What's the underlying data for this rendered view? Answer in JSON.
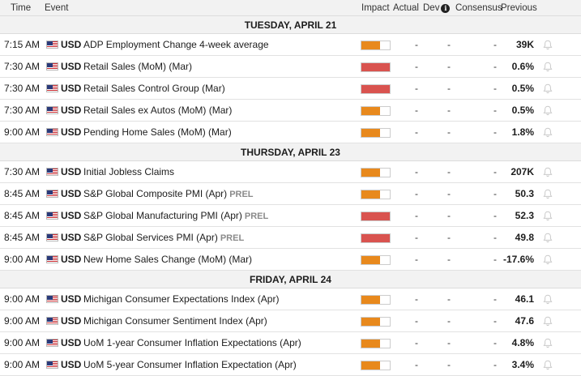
{
  "colors": {
    "impact_medium": "#e8891d",
    "impact_high": "#d9534f",
    "header_bg": "#f2f2f2"
  },
  "header": {
    "time": "Time",
    "event": "Event",
    "impact": "Impact",
    "actual": "Actual",
    "dev": "Dev",
    "info_icon": "i",
    "consensus": "Consensus",
    "previous": "Previous"
  },
  "days": [
    {
      "label": "TUESDAY, APRIL 21",
      "events": [
        {
          "time": "7:15 AM",
          "currency": "USD",
          "name": "ADP Employment Change 4-week average",
          "tag": "",
          "impact": "medium",
          "impact_level": 0.67,
          "actual": "-",
          "dev": "-",
          "consensus": "-",
          "previous": "39K"
        },
        {
          "time": "7:30 AM",
          "currency": "USD",
          "name": "Retail Sales (MoM) (Mar)",
          "tag": "",
          "impact": "high",
          "impact_level": 1,
          "actual": "-",
          "dev": "-",
          "consensus": "-",
          "previous": "0.6%"
        },
        {
          "time": "7:30 AM",
          "currency": "USD",
          "name": "Retail Sales Control Group (Mar)",
          "tag": "",
          "impact": "high",
          "impact_level": 1,
          "actual": "-",
          "dev": "-",
          "consensus": "-",
          "previous": "0.5%"
        },
        {
          "time": "7:30 AM",
          "currency": "USD",
          "name": "Retail Sales ex Autos (MoM) (Mar)",
          "tag": "",
          "impact": "medium",
          "impact_level": 0.67,
          "actual": "-",
          "dev": "-",
          "consensus": "-",
          "previous": "0.5%"
        },
        {
          "time": "9:00 AM",
          "currency": "USD",
          "name": "Pending Home Sales (MoM) (Mar)",
          "tag": "",
          "impact": "medium",
          "impact_level": 0.67,
          "actual": "-",
          "dev": "-",
          "consensus": "-",
          "previous": "1.8%"
        }
      ]
    },
    {
      "label": "THURSDAY, APRIL 23",
      "events": [
        {
          "time": "7:30 AM",
          "currency": "USD",
          "name": "Initial Jobless Claims",
          "tag": "",
          "impact": "medium",
          "impact_level": 0.67,
          "actual": "-",
          "dev": "-",
          "consensus": "-",
          "previous": "207K"
        },
        {
          "time": "8:45 AM",
          "currency": "USD",
          "name": "S&P Global Composite PMI (Apr)",
          "tag": "PREL",
          "impact": "medium",
          "impact_level": 0.67,
          "actual": "-",
          "dev": "-",
          "consensus": "-",
          "previous": "50.3"
        },
        {
          "time": "8:45 AM",
          "currency": "USD",
          "name": "S&P Global Manufacturing PMI (Apr)",
          "tag": "PREL",
          "impact": "high",
          "impact_level": 1,
          "actual": "-",
          "dev": "-",
          "consensus": "-",
          "previous": "52.3"
        },
        {
          "time": "8:45 AM",
          "currency": "USD",
          "name": "S&P Global Services PMI (Apr)",
          "tag": "PREL",
          "impact": "high",
          "impact_level": 1,
          "actual": "-",
          "dev": "-",
          "consensus": "-",
          "previous": "49.8"
        },
        {
          "time": "9:00 AM",
          "currency": "USD",
          "name": "New Home Sales Change (MoM) (Mar)",
          "tag": "",
          "impact": "medium",
          "impact_level": 0.67,
          "actual": "-",
          "dev": "-",
          "consensus": "-",
          "previous": "-17.6%"
        }
      ]
    },
    {
      "label": "FRIDAY, APRIL 24",
      "events": [
        {
          "time": "9:00 AM",
          "currency": "USD",
          "name": "Michigan Consumer Expectations Index (Apr)",
          "tag": "",
          "impact": "medium",
          "impact_level": 0.67,
          "actual": "-",
          "dev": "-",
          "consensus": "-",
          "previous": "46.1"
        },
        {
          "time": "9:00 AM",
          "currency": "USD",
          "name": "Michigan Consumer Sentiment Index (Apr)",
          "tag": "",
          "impact": "medium",
          "impact_level": 0.67,
          "actual": "-",
          "dev": "-",
          "consensus": "-",
          "previous": "47.6"
        },
        {
          "time": "9:00 AM",
          "currency": "USD",
          "name": "UoM 1-year Consumer Inflation Expectations (Apr)",
          "tag": "",
          "impact": "medium",
          "impact_level": 0.67,
          "actual": "-",
          "dev": "-",
          "consensus": "-",
          "previous": "4.8%"
        },
        {
          "time": "9:00 AM",
          "currency": "USD",
          "name": "UoM 5-year Consumer Inflation Expectation (Apr)",
          "tag": "",
          "impact": "medium",
          "impact_level": 0.67,
          "actual": "-",
          "dev": "-",
          "consensus": "-",
          "previous": "3.4%"
        }
      ]
    }
  ]
}
